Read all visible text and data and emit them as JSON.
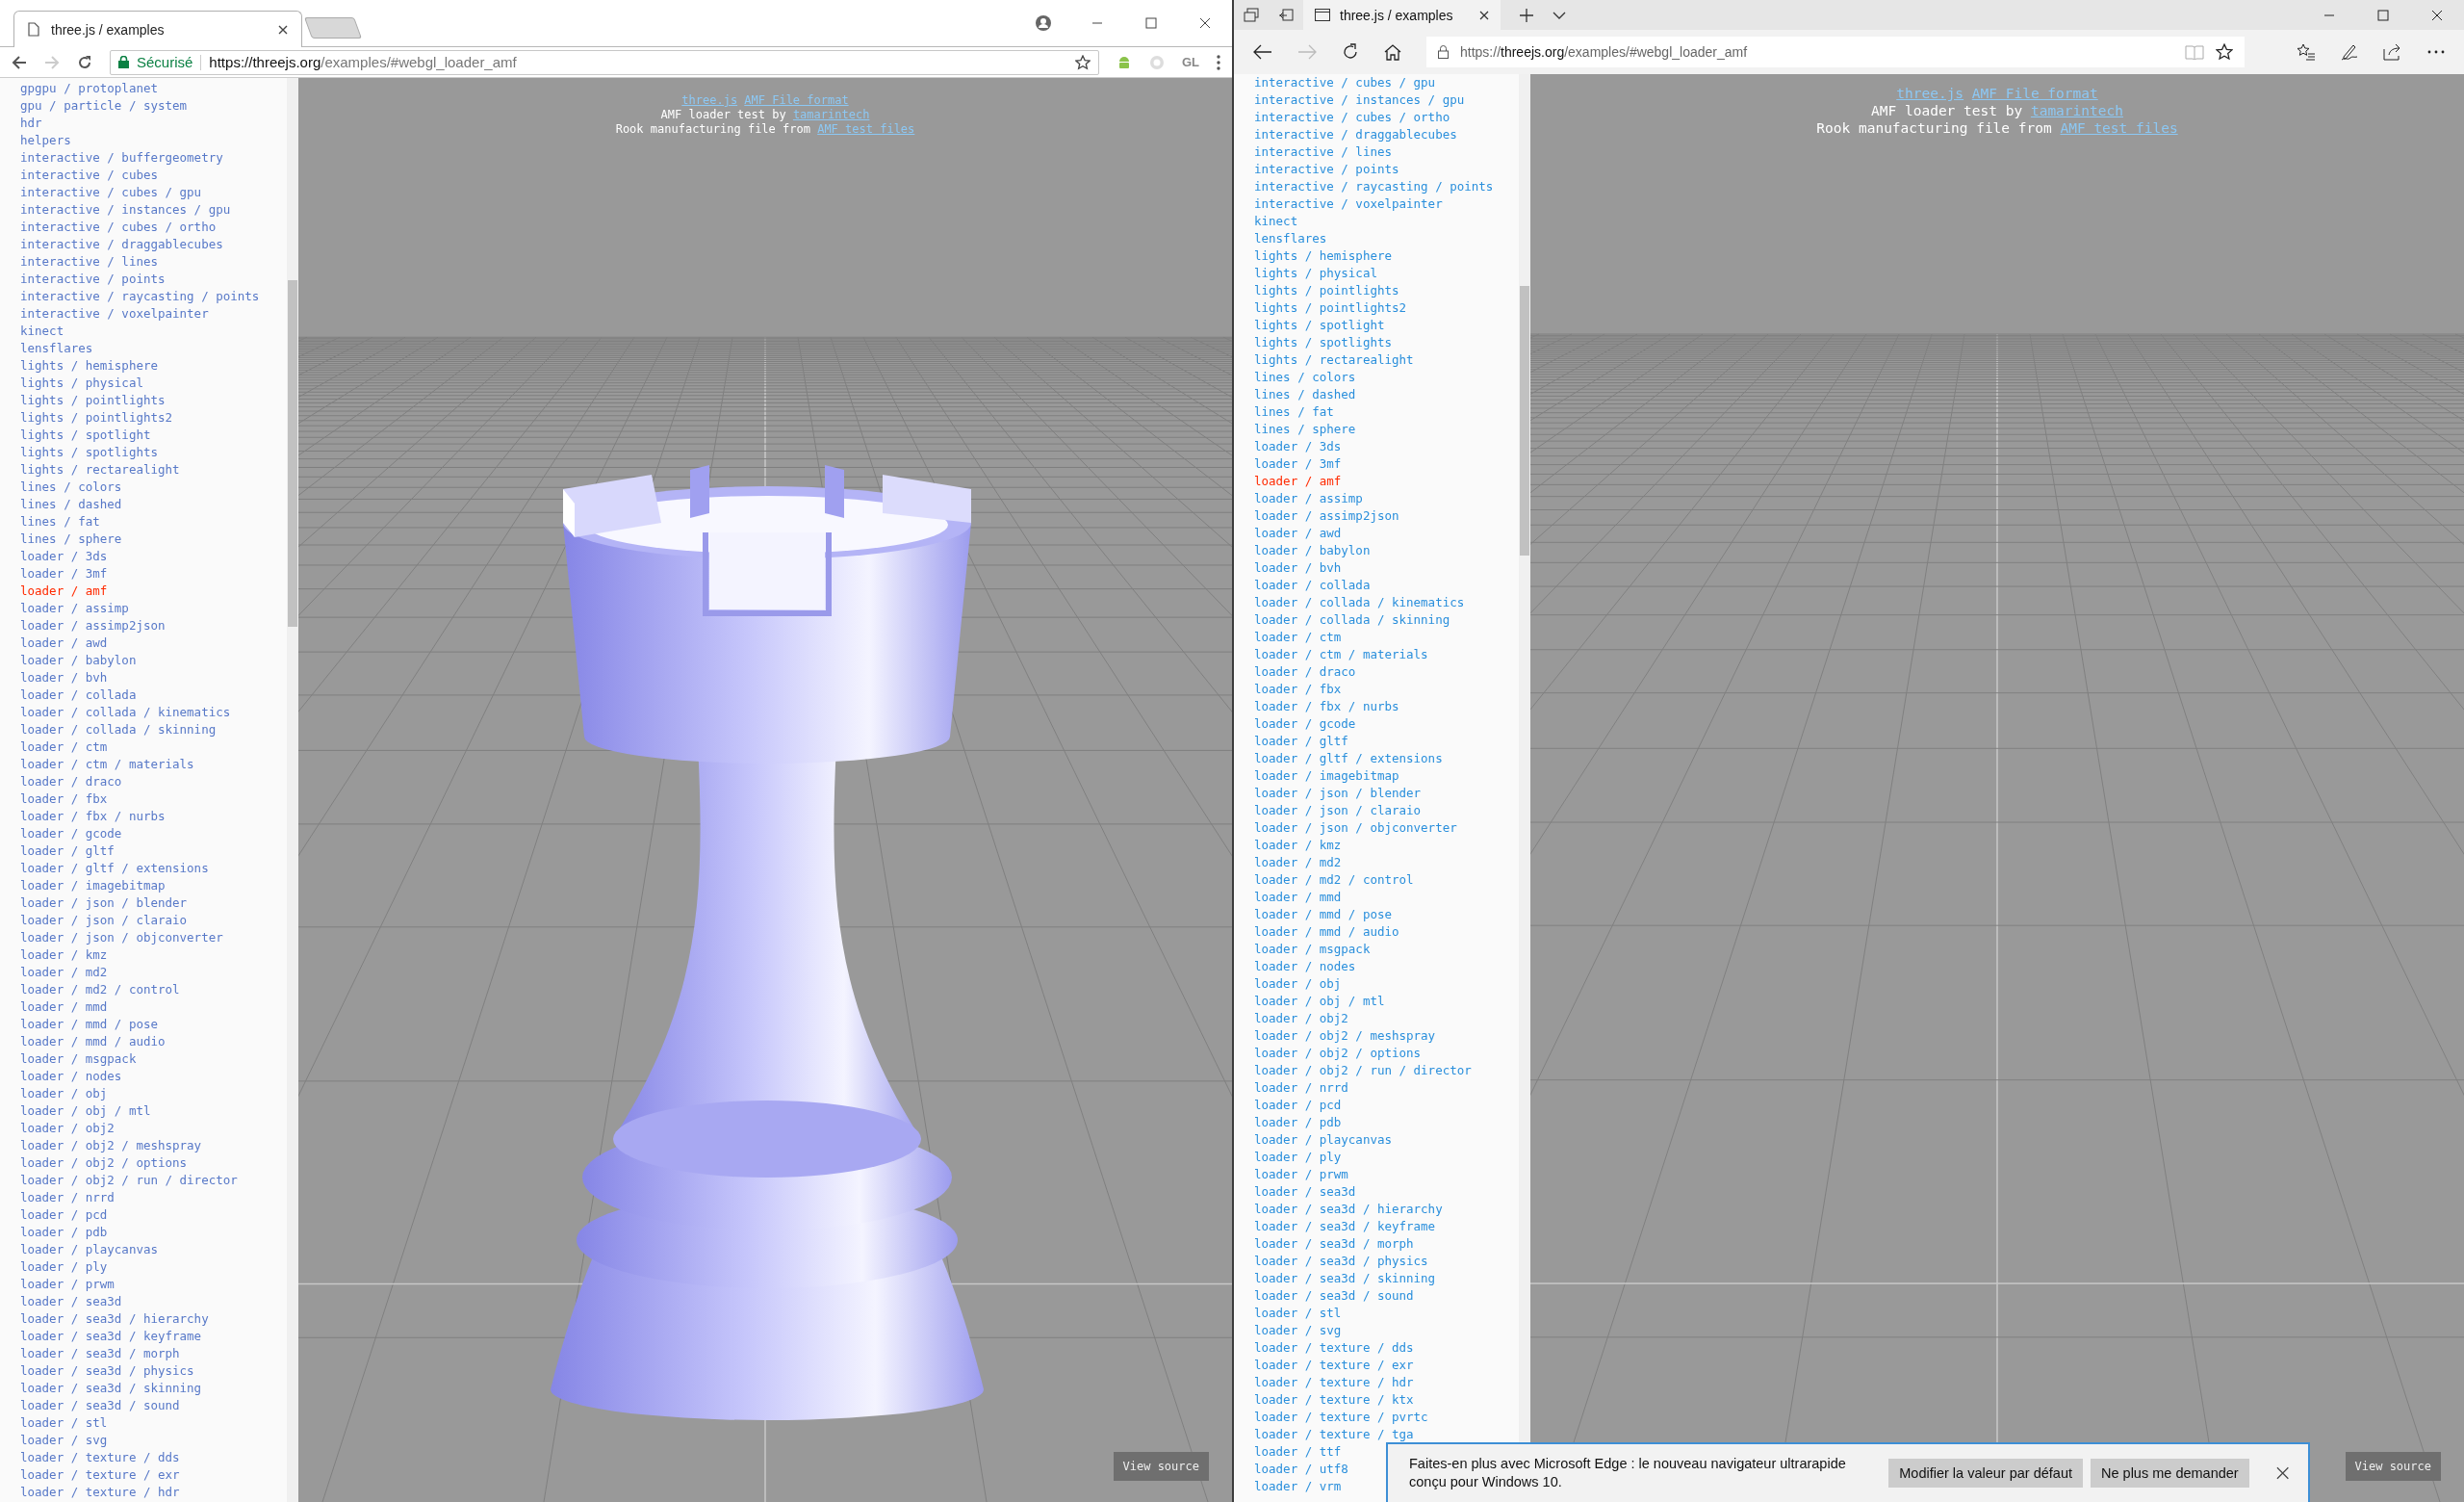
{
  "windows": [
    {
      "kind": "chrome",
      "tab": {
        "title": "three.js / examples"
      },
      "address": {
        "security_label": "Sécurisé",
        "scheme": "https://",
        "host": "threejs.org",
        "path": "/examples/#webgl_loader_amf"
      },
      "forward_disabled": true,
      "extension_label": "GL",
      "rook_shown": true,
      "sidebar": {
        "items": [
          {
            "label": "gpgpu / protoplanet",
            "selected": false
          },
          {
            "label": "gpu / particle / system",
            "selected": false
          },
          {
            "label": "hdr",
            "selected": false
          },
          {
            "label": "helpers",
            "selected": false
          },
          {
            "label": "interactive / buffergeometry",
            "selected": false
          },
          {
            "label": "interactive / cubes",
            "selected": false
          },
          {
            "label": "interactive / cubes / gpu",
            "selected": false
          },
          {
            "label": "interactive / instances / gpu",
            "selected": false
          },
          {
            "label": "interactive / cubes / ortho",
            "selected": false
          },
          {
            "label": "interactive / draggablecubes",
            "selected": false
          },
          {
            "label": "interactive / lines",
            "selected": false
          },
          {
            "label": "interactive / points",
            "selected": false
          },
          {
            "label": "interactive / raycasting / points",
            "selected": false
          },
          {
            "label": "interactive / voxelpainter",
            "selected": false
          },
          {
            "label": "kinect",
            "selected": false
          },
          {
            "label": "lensflares",
            "selected": false
          },
          {
            "label": "lights / hemisphere",
            "selected": false
          },
          {
            "label": "lights / physical",
            "selected": false
          },
          {
            "label": "lights / pointlights",
            "selected": false
          },
          {
            "label": "lights / pointlights2",
            "selected": false
          },
          {
            "label": "lights / spotlight",
            "selected": false
          },
          {
            "label": "lights / spotlights",
            "selected": false
          },
          {
            "label": "lights / rectarealight",
            "selected": false
          },
          {
            "label": "lines / colors",
            "selected": false
          },
          {
            "label": "lines / dashed",
            "selected": false
          },
          {
            "label": "lines / fat",
            "selected": false
          },
          {
            "label": "lines / sphere",
            "selected": false
          },
          {
            "label": "loader / 3ds",
            "selected": false
          },
          {
            "label": "loader / 3mf",
            "selected": false
          },
          {
            "label": "loader / amf",
            "selected": true
          },
          {
            "label": "loader / assimp",
            "selected": false
          },
          {
            "label": "loader / assimp2json",
            "selected": false
          },
          {
            "label": "loader / awd",
            "selected": false
          },
          {
            "label": "loader / babylon",
            "selected": false
          },
          {
            "label": "loader / bvh",
            "selected": false
          },
          {
            "label": "loader / collada",
            "selected": false
          },
          {
            "label": "loader / collada / kinematics",
            "selected": false
          },
          {
            "label": "loader / collada / skinning",
            "selected": false
          },
          {
            "label": "loader / ctm",
            "selected": false
          },
          {
            "label": "loader / ctm / materials",
            "selected": false
          },
          {
            "label": "loader / draco",
            "selected": false
          },
          {
            "label": "loader / fbx",
            "selected": false
          },
          {
            "label": "loader / fbx / nurbs",
            "selected": false
          },
          {
            "label": "loader / gcode",
            "selected": false
          },
          {
            "label": "loader / gltf",
            "selected": false
          },
          {
            "label": "loader / gltf / extensions",
            "selected": false
          },
          {
            "label": "loader / imagebitmap",
            "selected": false
          },
          {
            "label": "loader / json / blender",
            "selected": false
          },
          {
            "label": "loader / json / claraio",
            "selected": false
          },
          {
            "label": "loader / json / objconverter",
            "selected": false
          },
          {
            "label": "loader / kmz",
            "selected": false
          },
          {
            "label": "loader / md2",
            "selected": false
          },
          {
            "label": "loader / md2 / control",
            "selected": false
          },
          {
            "label": "loader / mmd",
            "selected": false
          },
          {
            "label": "loader / mmd / pose",
            "selected": false
          },
          {
            "label": "loader / mmd / audio",
            "selected": false
          },
          {
            "label": "loader / msgpack",
            "selected": false
          },
          {
            "label": "loader / nodes",
            "selected": false
          },
          {
            "label": "loader / obj",
            "selected": false
          },
          {
            "label": "loader / obj / mtl",
            "selected": false
          },
          {
            "label": "loader / obj2",
            "selected": false
          },
          {
            "label": "loader / obj2 / meshspray",
            "selected": false
          },
          {
            "label": "loader / obj2 / options",
            "selected": false
          },
          {
            "label": "loader / obj2 / run / director",
            "selected": false
          },
          {
            "label": "loader / nrrd",
            "selected": false
          },
          {
            "label": "loader / pcd",
            "selected": false
          },
          {
            "label": "loader / pdb",
            "selected": false
          },
          {
            "label": "loader / playcanvas",
            "selected": false
          },
          {
            "label": "loader / ply",
            "selected": false
          },
          {
            "label": "loader / prwm",
            "selected": false
          },
          {
            "label": "loader / sea3d",
            "selected": false
          },
          {
            "label": "loader / sea3d / hierarchy",
            "selected": false
          },
          {
            "label": "loader / sea3d / keyframe",
            "selected": false
          },
          {
            "label": "loader / sea3d / morph",
            "selected": false
          },
          {
            "label": "loader / sea3d / physics",
            "selected": false
          },
          {
            "label": "loader / sea3d / skinning",
            "selected": false
          },
          {
            "label": "loader / sea3d / sound",
            "selected": false
          },
          {
            "label": "loader / stl",
            "selected": false
          },
          {
            "label": "loader / svg",
            "selected": false
          },
          {
            "label": "loader / texture / dds",
            "selected": false
          },
          {
            "label": "loader / texture / exr",
            "selected": false
          },
          {
            "label": "loader / texture / hdr",
            "selected": false
          }
        ]
      },
      "info_lines": [
        {
          "links": [
            "three.js",
            "AMF File format"
          ]
        },
        {
          "text": "AMF loader test by",
          "link": "tamarintech"
        },
        {
          "text": "Rook manufacturing file from",
          "link": "AMF test files"
        }
      ],
      "view_source_button": "View source"
    },
    {
      "kind": "edge",
      "tab": {
        "title": "three.js / examples"
      },
      "address": {
        "scheme": "https://",
        "host": "threejs.org",
        "path": "/examples/#webgl_loader_amf"
      },
      "forward_disabled": true,
      "rook_shown": false,
      "sidebar": {
        "items": [
          {
            "label": "interactive / cubes / gpu",
            "selected": false
          },
          {
            "label": "interactive / instances / gpu",
            "selected": false
          },
          {
            "label": "interactive / cubes / ortho",
            "selected": false
          },
          {
            "label": "interactive / draggablecubes",
            "selected": false
          },
          {
            "label": "interactive / lines",
            "selected": false
          },
          {
            "label": "interactive / points",
            "selected": false
          },
          {
            "label": "interactive / raycasting / points",
            "selected": false
          },
          {
            "label": "interactive / voxelpainter",
            "selected": false
          },
          {
            "label": "kinect",
            "selected": false
          },
          {
            "label": "lensflares",
            "selected": false
          },
          {
            "label": "lights / hemisphere",
            "selected": false
          },
          {
            "label": "lights / physical",
            "selected": false
          },
          {
            "label": "lights / pointlights",
            "selected": false
          },
          {
            "label": "lights / pointlights2",
            "selected": false
          },
          {
            "label": "lights / spotlight",
            "selected": false
          },
          {
            "label": "lights / spotlights",
            "selected": false
          },
          {
            "label": "lights / rectarealight",
            "selected": false
          },
          {
            "label": "lines / colors",
            "selected": false
          },
          {
            "label": "lines / dashed",
            "selected": false
          },
          {
            "label": "lines / fat",
            "selected": false
          },
          {
            "label": "lines / sphere",
            "selected": false
          },
          {
            "label": "loader / 3ds",
            "selected": false
          },
          {
            "label": "loader / 3mf",
            "selected": false
          },
          {
            "label": "loader / amf",
            "selected": true
          },
          {
            "label": "loader / assimp",
            "selected": false
          },
          {
            "label": "loader / assimp2json",
            "selected": false
          },
          {
            "label": "loader / awd",
            "selected": false
          },
          {
            "label": "loader / babylon",
            "selected": false
          },
          {
            "label": "loader / bvh",
            "selected": false
          },
          {
            "label": "loader / collada",
            "selected": false
          },
          {
            "label": "loader / collada / kinematics",
            "selected": false
          },
          {
            "label": "loader / collada / skinning",
            "selected": false
          },
          {
            "label": "loader / ctm",
            "selected": false
          },
          {
            "label": "loader / ctm / materials",
            "selected": false
          },
          {
            "label": "loader / draco",
            "selected": false
          },
          {
            "label": "loader / fbx",
            "selected": false
          },
          {
            "label": "loader / fbx / nurbs",
            "selected": false
          },
          {
            "label": "loader / gcode",
            "selected": false
          },
          {
            "label": "loader / gltf",
            "selected": false
          },
          {
            "label": "loader / gltf / extensions",
            "selected": false
          },
          {
            "label": "loader / imagebitmap",
            "selected": false
          },
          {
            "label": "loader / json / blender",
            "selected": false
          },
          {
            "label": "loader / json / claraio",
            "selected": false
          },
          {
            "label": "loader / json / objconverter",
            "selected": false
          },
          {
            "label": "loader / kmz",
            "selected": false
          },
          {
            "label": "loader / md2",
            "selected": false
          },
          {
            "label": "loader / md2 / control",
            "selected": false
          },
          {
            "label": "loader / mmd",
            "selected": false
          },
          {
            "label": "loader / mmd / pose",
            "selected": false
          },
          {
            "label": "loader / mmd / audio",
            "selected": false
          },
          {
            "label": "loader / msgpack",
            "selected": false
          },
          {
            "label": "loader / nodes",
            "selected": false
          },
          {
            "label": "loader / obj",
            "selected": false
          },
          {
            "label": "loader / obj / mtl",
            "selected": false
          },
          {
            "label": "loader / obj2",
            "selected": false
          },
          {
            "label": "loader / obj2 / meshspray",
            "selected": false
          },
          {
            "label": "loader / obj2 / options",
            "selected": false
          },
          {
            "label": "loader / obj2 / run / director",
            "selected": false
          },
          {
            "label": "loader / nrrd",
            "selected": false
          },
          {
            "label": "loader / pcd",
            "selected": false
          },
          {
            "label": "loader / pdb",
            "selected": false
          },
          {
            "label": "loader / playcanvas",
            "selected": false
          },
          {
            "label": "loader / ply",
            "selected": false
          },
          {
            "label": "loader / prwm",
            "selected": false
          },
          {
            "label": "loader / sea3d",
            "selected": false
          },
          {
            "label": "loader / sea3d / hierarchy",
            "selected": false
          },
          {
            "label": "loader / sea3d / keyframe",
            "selected": false
          },
          {
            "label": "loader / sea3d / morph",
            "selected": false
          },
          {
            "label": "loader / sea3d / physics",
            "selected": false
          },
          {
            "label": "loader / sea3d / skinning",
            "selected": false
          },
          {
            "label": "loader / sea3d / sound",
            "selected": false
          },
          {
            "label": "loader / stl",
            "selected": false
          },
          {
            "label": "loader / svg",
            "selected": false
          },
          {
            "label": "loader / texture / dds",
            "selected": false
          },
          {
            "label": "loader / texture / exr",
            "selected": false
          },
          {
            "label": "loader / texture / hdr",
            "selected": false
          },
          {
            "label": "loader / texture / ktx",
            "selected": false
          },
          {
            "label": "loader / texture / pvrtc",
            "selected": false
          },
          {
            "label": "loader / texture / tga",
            "selected": false
          },
          {
            "label": "loader / ttf",
            "selected": false
          },
          {
            "label": "loader / utf8",
            "selected": false
          },
          {
            "label": "loader / vrm",
            "selected": false
          }
        ]
      },
      "info_lines": [
        {
          "links": [
            "three.js",
            "AMF File format"
          ]
        },
        {
          "text": "AMF loader test by",
          "link": "tamarintech"
        },
        {
          "text": "Rook manufacturing file from",
          "link": "AMF test files"
        }
      ],
      "view_source_button": "View source",
      "notification": {
        "message": "Faites-en plus avec Microsoft Edge : le nouveau navigateur ultrarapide conçu pour Windows 10.",
        "buttons": [
          "Modifier la valeur par défaut",
          "Ne plus me demander"
        ]
      }
    }
  ]
}
